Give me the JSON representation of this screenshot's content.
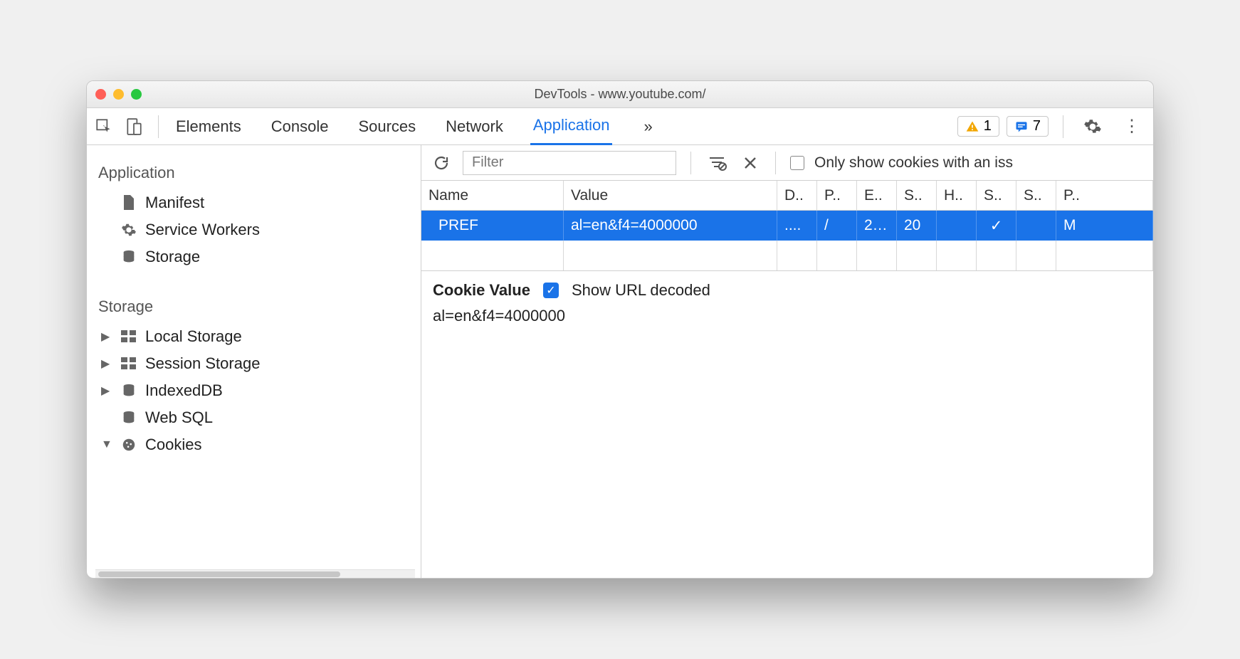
{
  "window": {
    "title": "DevTools - www.youtube.com/"
  },
  "toolbar": {
    "tabs": [
      "Elements",
      "Console",
      "Sources",
      "Network",
      "Application"
    ],
    "active_tab": "Application",
    "overflow": "»",
    "warn_count": "1",
    "msg_count": "7"
  },
  "sidebar": {
    "sections": [
      {
        "title": "Application",
        "items": [
          {
            "label": "Manifest",
            "icon": "file"
          },
          {
            "label": "Service Workers",
            "icon": "gear"
          },
          {
            "label": "Storage",
            "icon": "db"
          }
        ]
      },
      {
        "title": "Storage",
        "items": [
          {
            "label": "Local Storage",
            "icon": "grid",
            "expandable": true
          },
          {
            "label": "Session Storage",
            "icon": "grid",
            "expandable": true
          },
          {
            "label": "IndexedDB",
            "icon": "db",
            "expandable": true
          },
          {
            "label": "Web SQL",
            "icon": "db"
          },
          {
            "label": "Cookies",
            "icon": "cookie",
            "expanded": true
          }
        ]
      }
    ]
  },
  "subbar": {
    "filter_placeholder": "Filter",
    "only_issue_label": "Only show cookies with an iss"
  },
  "table": {
    "headers": [
      "Name",
      "Value",
      "D..",
      "P..",
      "E..",
      "S..",
      "H..",
      "S..",
      "S..",
      "P.."
    ],
    "row": {
      "name": "PREF",
      "value": "al=en&f4=4000000",
      "domain": "....",
      "path": "/",
      "expires": "2…",
      "size": "20",
      "httponly": "",
      "secure": "✓",
      "samesite": "",
      "priority": "M"
    }
  },
  "detail": {
    "heading": "Cookie Value",
    "decode_label": "Show URL decoded",
    "value": "al=en&f4=4000000"
  }
}
